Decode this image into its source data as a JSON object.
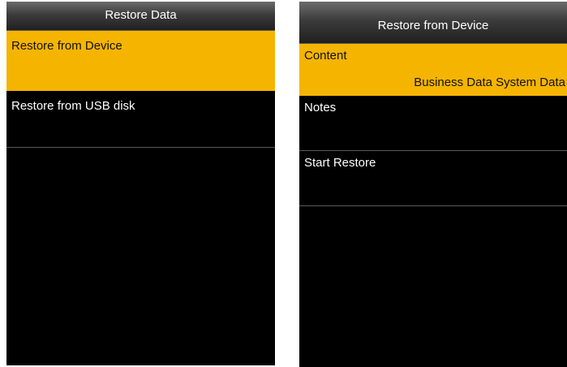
{
  "left_screen": {
    "title": "Restore Data",
    "items": [
      {
        "label": "Restore from Device",
        "selected": true
      },
      {
        "label": "Restore from USB disk",
        "selected": false
      }
    ]
  },
  "right_screen": {
    "title": "Restore from Device",
    "items": [
      {
        "label": "Content",
        "value": "Business Data System Data",
        "selected": true
      },
      {
        "label": "Notes",
        "selected": false
      },
      {
        "label": "Start Restore",
        "selected": false
      }
    ]
  },
  "colors": {
    "highlight": "#f5b400",
    "background": "#000000",
    "text": "#ffffff"
  }
}
